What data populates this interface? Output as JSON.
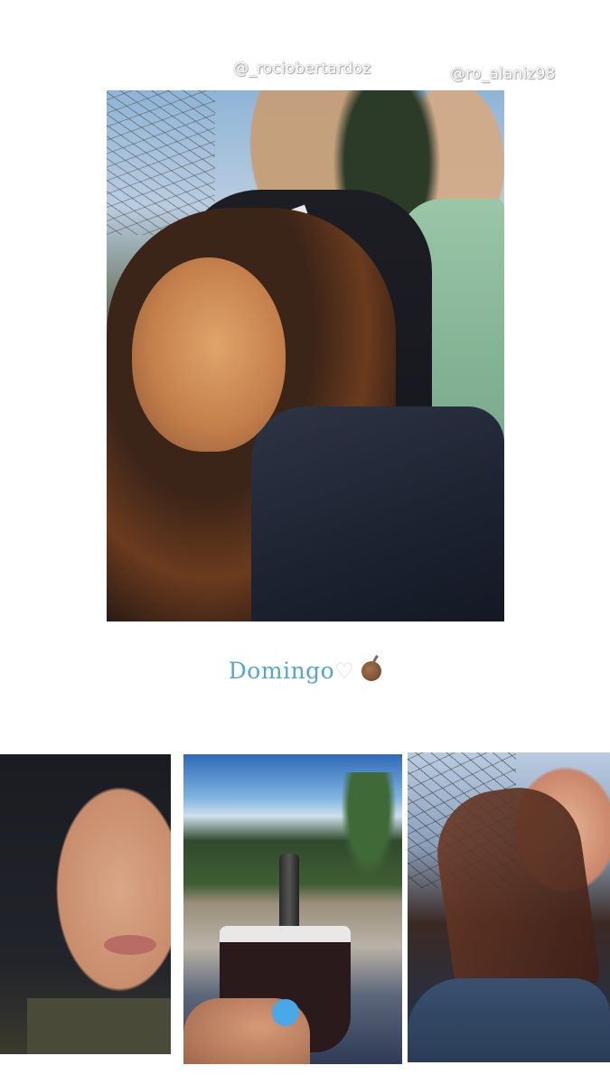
{
  "story": {
    "mentions": [
      "@_rociobertardoz",
      "@ro_alaniz98"
    ],
    "caption": {
      "text": "Domingo",
      "emojis": [
        "white-heart",
        "coconut-mate"
      ]
    },
    "photos": {
      "main": "group-selfie-three-friends",
      "bottom": [
        "close-up-face-portrait",
        "mate-cup-in-park",
        "wind-blown-hair-portrait"
      ]
    },
    "colors": {
      "background": "#ffffff",
      "caption": "#55a6c8"
    }
  }
}
